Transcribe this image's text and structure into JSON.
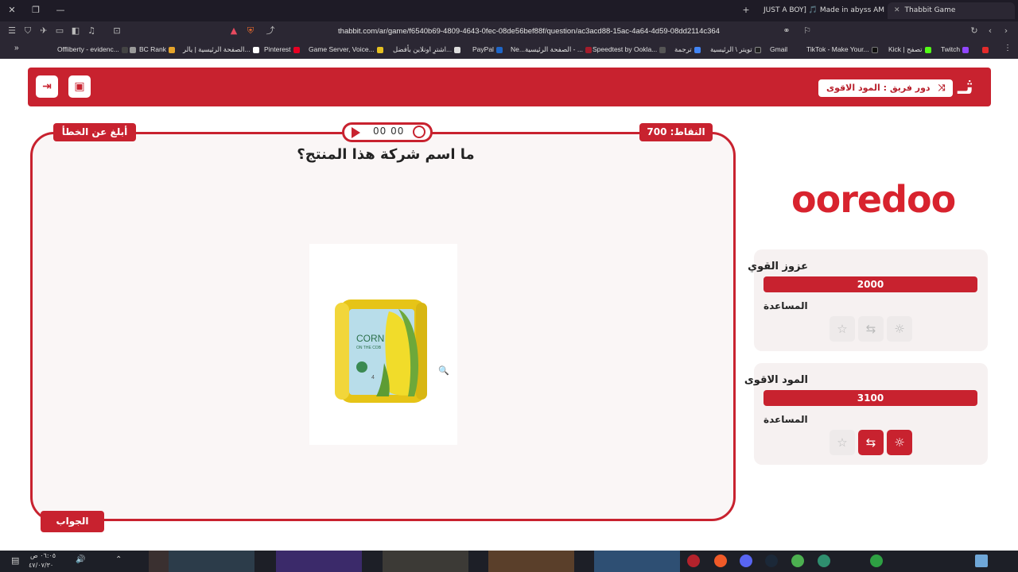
{
  "browser": {
    "tabs": [
      {
        "label": "JUST A BOY] 🎵 Made in abyss AM\\"
      },
      {
        "label": "Thabbit Game"
      }
    ],
    "url": "thabbit.com/ar/game/f6540b69-4809-4643-0fec-08de56bef88f/question/ac3acd88-15ac-4a64-4d59-08dd2114c364",
    "bookmarks": [
      "Offliberty - evidenc...",
      "BC Rank",
      "الصفحة الرئيسية | يالر...",
      "Pinterest",
      "Game Server, Voice...",
      "اشترِ اونلاين بأفضل...",
      "PayPal",
      "Ne...",
      "الصفحة الرئيسية - ...",
      "Speedtest by Ookla...",
      "ترجمة",
      "تويتر \\ الرئيسية",
      "Gmail",
      "TikTok - Make Your...",
      "Kick | تصفح",
      "Twitch"
    ]
  },
  "header": {
    "turn_label": "دور فريق : المود الاقوى",
    "logo_glyph": "ثـ"
  },
  "question": {
    "report_label": "أبلغ عن الخطأ",
    "points_label": "النقاط: 700",
    "timer": "00 00",
    "text": "ما اسم شركة هذا المنتج؟",
    "answer_label": "الجواب",
    "image_text": "CORN",
    "image_subtext": "ON THE COB"
  },
  "category": {
    "brand": "ooredoo"
  },
  "teams": [
    {
      "name": "عزوز القوي",
      "score": "2000",
      "help_title": "المساعدة"
    },
    {
      "name": "المود الاقوى",
      "score": "3100",
      "help_title": "المساعدة"
    }
  ],
  "taskbar": {
    "time": "٠٦:٠٥ ص",
    "date": "٤٧/٠٧/٣٠"
  }
}
